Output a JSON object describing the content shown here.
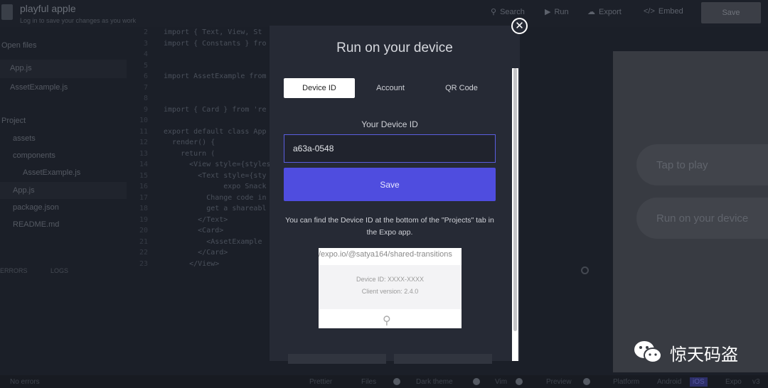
{
  "project": {
    "title": "playful apple",
    "subtitle": "Log in to save your changes as you work"
  },
  "toolbar": {
    "search": "Search",
    "run": "Run",
    "export": "Export",
    "embed": "Embed",
    "save": "Save"
  },
  "sidebar": {
    "open_files_header": "Open files",
    "open_files": [
      "App.js",
      "AssetExample.js"
    ],
    "project_header": "Project",
    "project_items": [
      "assets",
      "components",
      "AssetExample.js",
      "App.js",
      "package.json",
      "README.md"
    ]
  },
  "code": {
    "lines": [
      {
        "n": "2",
        "t": "import { Text, View, St"
      },
      {
        "n": "3",
        "t": "import { Constants } fro"
      },
      {
        "n": "4",
        "t": ""
      },
      {
        "n": "5",
        "t": ""
      },
      {
        "n": "6",
        "t": "import AssetExample from"
      },
      {
        "n": "7",
        "t": ""
      },
      {
        "n": "8",
        "t": ""
      },
      {
        "n": "9",
        "t": "import { Card } from 're"
      },
      {
        "n": "10",
        "t": ""
      },
      {
        "n": "11",
        "t": "export default class App"
      },
      {
        "n": "12",
        "t": "  render() {"
      },
      {
        "n": "13",
        "t": "    return ("
      },
      {
        "n": "14",
        "t": "      <View style={styles"
      },
      {
        "n": "15",
        "t": "        <Text style={sty"
      },
      {
        "n": "16",
        "t": "              expo Snack"
      },
      {
        "n": "17",
        "t": "          Change code in"
      },
      {
        "n": "18",
        "t": "          get a shareabl"
      },
      {
        "n": "19",
        "t": "        </Text>"
      },
      {
        "n": "20",
        "t": "        <Card>"
      },
      {
        "n": "21",
        "t": "          <AssetExample"
      },
      {
        "n": "22",
        "t": "        </Card>"
      },
      {
        "n": "23",
        "t": "      </View>"
      }
    ]
  },
  "errors_panel": {
    "errors_tab": "ERRORS",
    "logs_tab": "LOGS"
  },
  "modal": {
    "title": "Run on your device",
    "tabs": [
      "Device ID",
      "Account",
      "QR Code"
    ],
    "active_tab": "Device ID",
    "field_label": "Your Device ID",
    "device_id_value": "a63a-0548",
    "save_label": "Save",
    "help_text": "You can find the Device ID at the bottom of the \"Projects\" tab in the Expo app.",
    "screenshot": {
      "url": "/expo.io/@satya164/shared-transitions",
      "device_id": "Device ID: XXXX-XXXX",
      "client_version": "Client version: 2.4.0"
    }
  },
  "preview": {
    "tap_to_play": "Tap to play",
    "run_on_device": "Run on your device"
  },
  "statusbar": {
    "errors": "No errors",
    "prettier": "Prettier",
    "files": "Files",
    "dark_theme": "Dark theme",
    "vim": "Vim",
    "preview": "Preview",
    "platform": "Platform",
    "android": "Android",
    "ios": "iOS",
    "expo": "Expo",
    "version": "v3"
  },
  "watermark": "惊天码盗",
  "colors": {
    "accent": "#4f4ddf",
    "modal_bg": "#262a35",
    "background": "#1b1f28"
  }
}
